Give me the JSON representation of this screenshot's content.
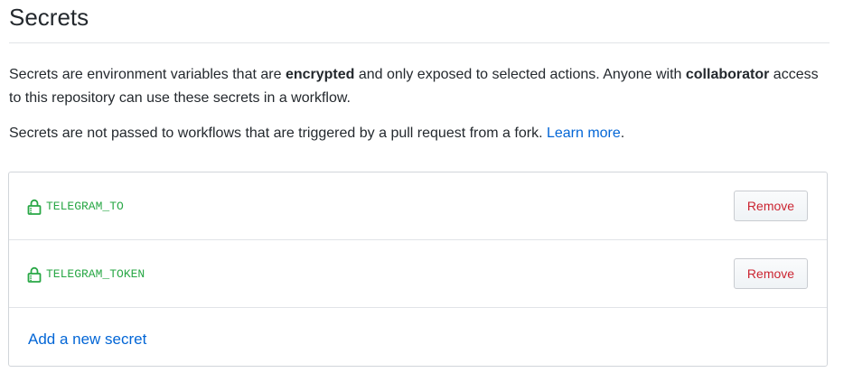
{
  "header": {
    "title": "Secrets"
  },
  "description": {
    "p1_part1": "Secrets are environment variables that are ",
    "p1_bold1": "encrypted",
    "p1_part2": " and only exposed to selected actions. Anyone with ",
    "p1_bold2": "collaborator",
    "p1_part3": " access to this repository can use these secrets in a workflow.",
    "p2_text": "Secrets are not passed to workflows that are triggered by a pull request from a fork. ",
    "p2_link": "Learn more",
    "p2_end": "."
  },
  "secrets": [
    {
      "name": "TELEGRAM_TO",
      "icon": "lock-icon",
      "remove_label": "Remove"
    },
    {
      "name": "TELEGRAM_TOKEN",
      "icon": "lock-icon",
      "remove_label": "Remove"
    }
  ],
  "add_secret_label": "Add a new secret",
  "colors": {
    "secret_name": "#28a745",
    "link": "#0366d6",
    "remove_text": "#cb2431",
    "border": "#d1d5da"
  }
}
